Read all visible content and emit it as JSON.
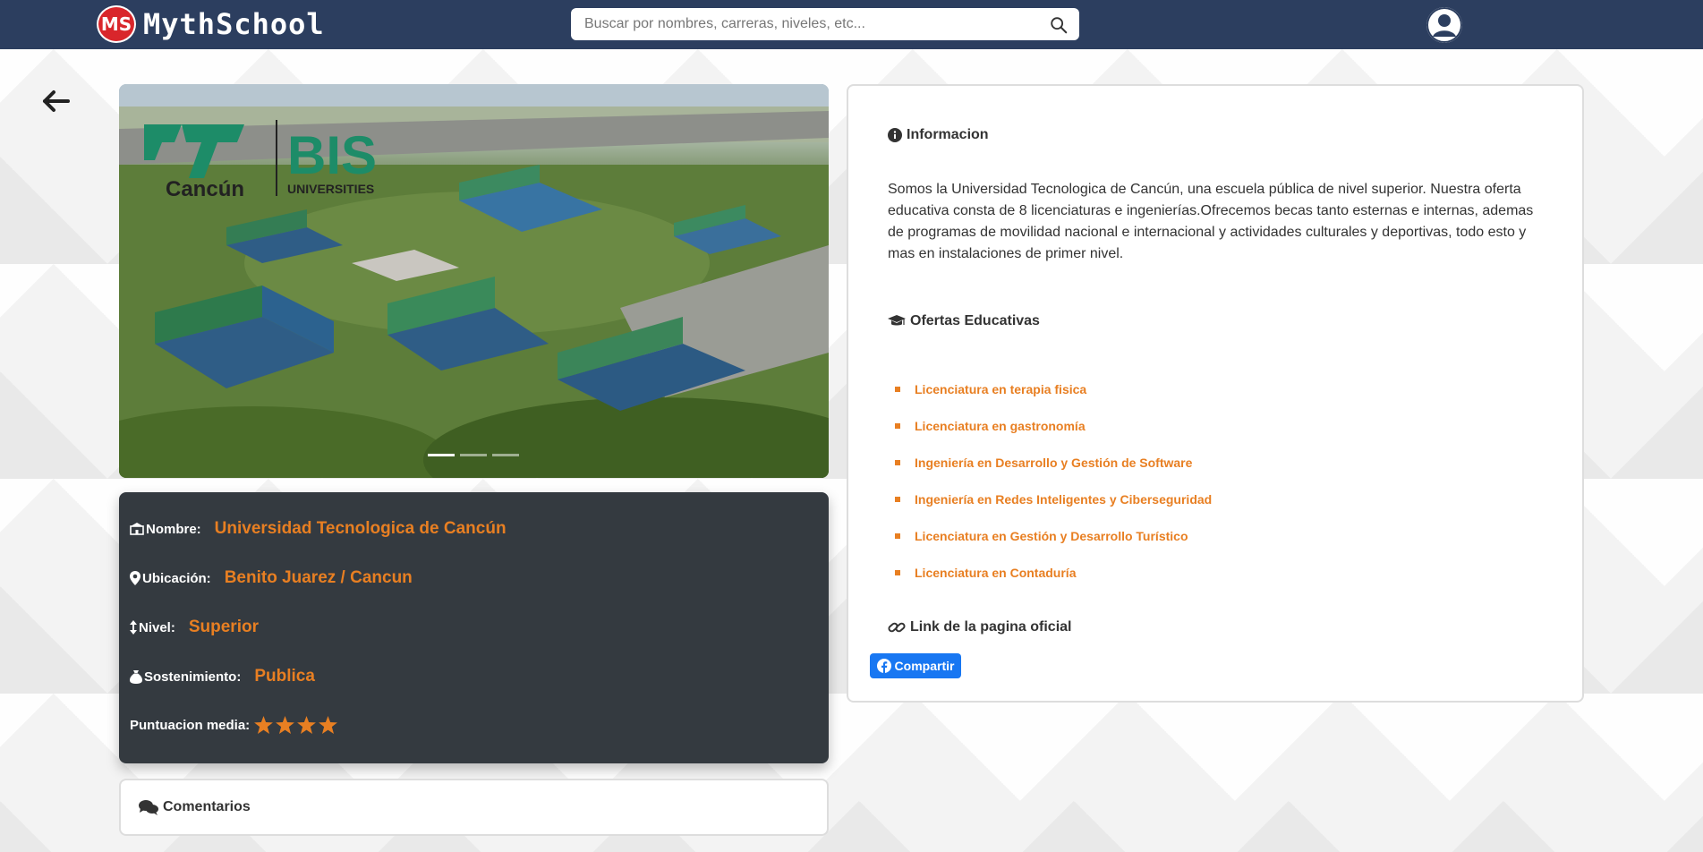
{
  "navbar": {
    "logo_badge": "MS",
    "logo_text": "MythSchool",
    "search_placeholder": "Buscar por nombres, carreras, niveles, etc..."
  },
  "carousel": {
    "logo_brand_left": "Cancún",
    "logo_brand_right": "UNIVERSITIES",
    "indicator_count": 3,
    "active_indicator": 0
  },
  "school": {
    "name_label": "Nombre:",
    "name": "Universidad Tecnologica de Cancún",
    "location_label": "Ubicación:",
    "location": "Benito Juarez / Cancun",
    "level_label": "Nivel:",
    "level": "Superior",
    "funding_label": "Sostenimiento:",
    "funding": "Publica",
    "rating_label": "Puntuacion media:",
    "rating": 4
  },
  "comments": {
    "title": "Comentarios"
  },
  "info": {
    "title": "Informacion",
    "description": "Somos la Universidad Tecnologica de Cancún, una escuela pública de nivel superior. Nuestra oferta educativa consta de 8 licenciaturas e ingenierías.Ofrecemos becas tanto esternas e internas, ademas de programas de movilidad nacional e internacional y actividades culturales y deportivas, todo esto y mas en instalaciones de primer nivel.",
    "ofertas_title": "Ofertas Educativas",
    "ofertas": [
      "Licenciatura en terapia fisica",
      "Licenciatura en gastronomía",
      "Ingeniería en Desarrollo y Gestión de Software",
      "Ingeniería en Redes Inteligentes y Ciberseguridad",
      "Licenciatura en Gestión y Desarrollo Turístico",
      "Licenciatura en Contaduría"
    ],
    "link_title": "Link de la pagina oficial",
    "share_label": "Compartir"
  },
  "colors": {
    "navbar": "#2c3e5f",
    "accent": "#e87f22",
    "dark_card": "#343a40",
    "facebook": "#1877f2"
  }
}
